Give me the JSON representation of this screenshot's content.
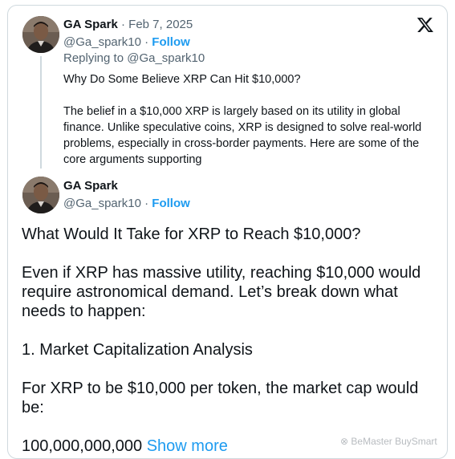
{
  "quoted_tweet": {
    "author_name": "GA Spark",
    "separator": " · ",
    "date": "Feb 7, 2025",
    "handle": "@Ga_spark10",
    "dot": " · ",
    "follow_label": "Follow",
    "replying_to": "Replying to @Ga_spark10",
    "paragraphs": [
      "Why Do Some Believe XRP Can Hit $10,000?",
      "The belief in a $10,000 XRP is largely based on its utility in global finance. Unlike speculative coins, XRP is designed to solve real-world problems, especially in cross-border payments. Here are some of the core arguments supporting"
    ]
  },
  "main_tweet": {
    "author_name": "GA Spark",
    "handle": "@Ga_spark10",
    "dot": " · ",
    "follow_label": "Follow",
    "paragraphs": {
      "p1": "What Would It Take for XRP to Reach $10,000?",
      "p2_l1": "Even if XRP has massive utility, reaching $10,000 would",
      "p2_l2": "require astronomical demand. Let’s break down what",
      "p2_l3": "needs to happen:",
      "p3": "1. Market Capitalization Analysis",
      "p4_l1": "For XRP to be $10,000 per token, the market cap would",
      "p4_l2": "be:",
      "p5": "100,000,000,000 ",
      "show_more": "Show more"
    }
  },
  "icons": {
    "platform_logo": "x-logo-icon",
    "avatar": "avatar-photo"
  },
  "watermark": "⊗ BeMaster BuySmart",
  "colors": {
    "link": "#1d9bf0",
    "muted": "#536471",
    "text": "#0f1419",
    "border": "#cfd9de"
  }
}
